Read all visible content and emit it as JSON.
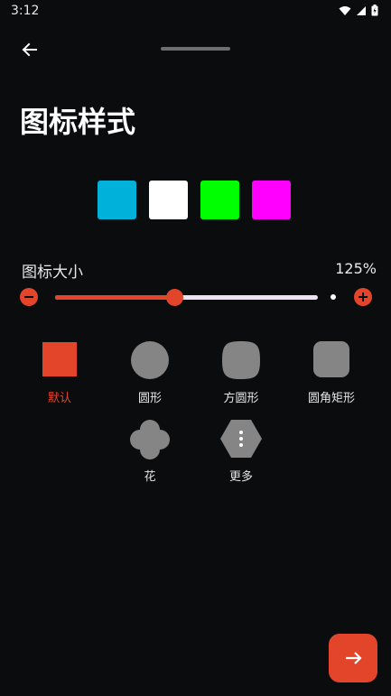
{
  "status_bar": {
    "time": "3:12"
  },
  "page": {
    "title": "图标样式"
  },
  "colors": {
    "accent": "#e3452b",
    "swatches": [
      "#00b1d9",
      "#ffffff",
      "#00ff00",
      "#ff00ff"
    ]
  },
  "icon_size": {
    "label": "图标大小",
    "value_text": "125%",
    "level_fraction": 0.45
  },
  "shapes": [
    {
      "label": "默认",
      "icon": "square-shape-icon",
      "selected": true
    },
    {
      "label": "圆形",
      "icon": "circle-shape-icon",
      "selected": false
    },
    {
      "label": "方圆形",
      "icon": "squircle-shape-icon",
      "selected": false
    },
    {
      "label": "圆角矩形",
      "icon": "rounded-rect-shape-icon",
      "selected": false
    },
    {
      "label": "花",
      "icon": "flower-shape-icon",
      "selected": false
    },
    {
      "label": "更多",
      "icon": "more-hexagon-icon",
      "selected": false
    }
  ],
  "fab": {
    "icon": "arrow-right-icon"
  }
}
